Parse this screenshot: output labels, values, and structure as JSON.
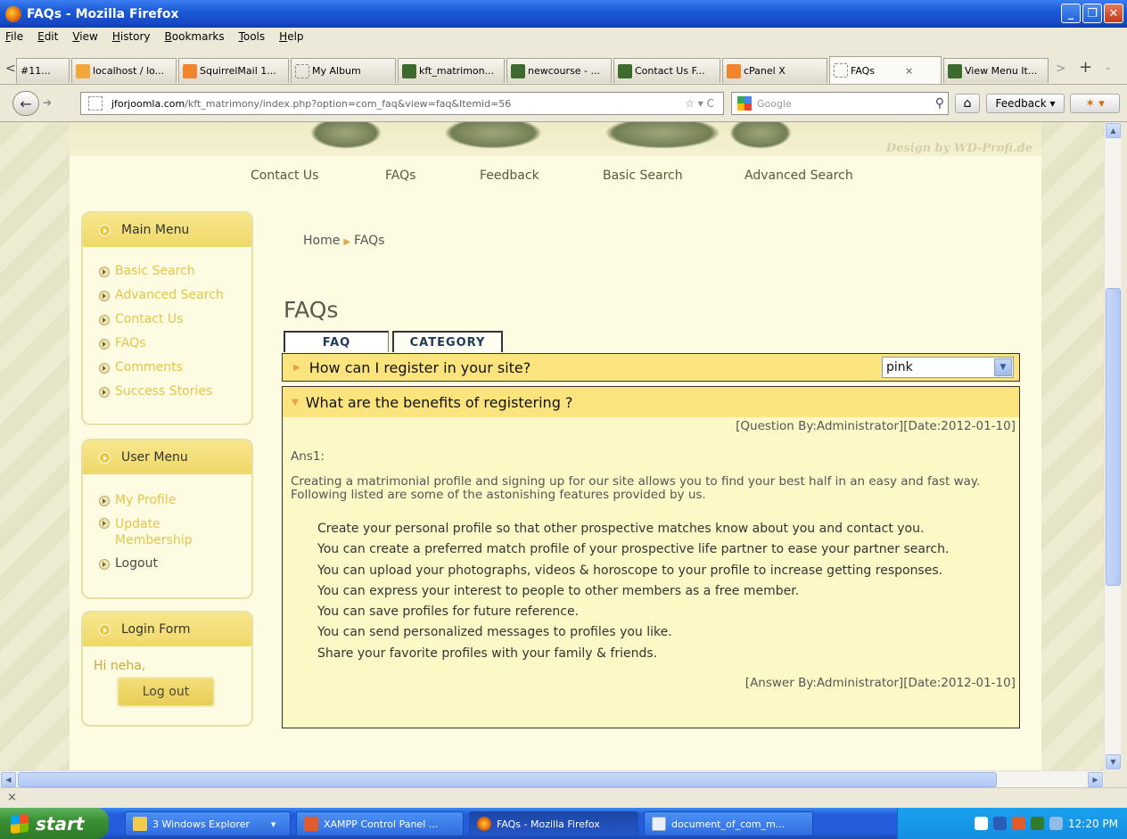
{
  "window": {
    "title": "FAQs - Mozilla Firefox"
  },
  "menubar": [
    "File",
    "Edit",
    "View",
    "History",
    "Bookmarks",
    "Tools",
    "Help"
  ],
  "tabs": [
    {
      "label": "#11...",
      "icon": "none"
    },
    {
      "label": "localhost / lo...",
      "icon": "phpmyadmin-icon"
    },
    {
      "label": "SquirrelMail 1...",
      "icon": "cpanel-icon"
    },
    {
      "label": "My Album",
      "icon": "blank-page-icon"
    },
    {
      "label": "kft_matrimon...",
      "icon": "joomla-icon"
    },
    {
      "label": "newcourse - ...",
      "icon": "joomla-icon"
    },
    {
      "label": "Contact Us F...",
      "icon": "joomla-icon"
    },
    {
      "label": "cPanel X",
      "icon": "cpanel-icon"
    },
    {
      "label": "FAQs",
      "icon": "blank-page-icon",
      "active": true
    },
    {
      "label": "View Menu It...",
      "icon": "joomla-icon"
    }
  ],
  "navbar": {
    "url_domain": "jforjoomla.com",
    "url_path": "/kft_matrimony/index.php?option=com_faq&view=faq&Itemid=56",
    "search_placeholder": "Google",
    "feedback_label": "Feedback"
  },
  "page": {
    "design_credit": "Design by WD-Profi.de",
    "topnav": [
      "Contact Us",
      "FAQs",
      "Feedback",
      "Basic Search",
      "Advanced Search"
    ],
    "main_menu": {
      "title": "Main Menu",
      "items": [
        "Basic Search",
        "Advanced Search",
        "Contact Us",
        "FAQs",
        "Comments",
        "Success Stories"
      ]
    },
    "user_menu": {
      "title": "User Menu",
      "items": [
        "My Profile",
        "Update Membership",
        "Logout"
      ]
    },
    "login_form": {
      "title": "Login Form",
      "greeting": "Hi neha,",
      "logout_button": "Log out"
    },
    "breadcrumb": {
      "home": "Home",
      "current": "FAQs"
    },
    "heading": "FAQs",
    "faq_tabs": [
      "FAQ",
      "CATEGORY"
    ],
    "theme_select": "pink",
    "questions": [
      {
        "question": "How can I register in your site?",
        "expanded": false
      },
      {
        "question": "What are the benefits of registering ?",
        "expanded": true,
        "question_meta": "[Question By:Administrator][Date:2012-01-10]",
        "answer_label": "Ans1:",
        "answer_intro": "Creating a matrimonial profile and signing up for our site allows you to find your best half in an easy and fast way. Following listed are some of the astonishing features provided by us.",
        "answer_points": [
          "Create your personal profile so that other prospective matches know about you and contact you.",
          "You can create a preferred match profile of your prospective life partner to ease your partner search.",
          "You can upload your photographs, videos & horoscope to your profile to increase getting responses.",
          "You can express your interest to people to other members as a free member.",
          "You can save profiles for future reference.",
          "You can send personalized messages to profiles you like.",
          "Share your favorite profiles with your family & friends."
        ],
        "answer_meta": "[Answer By:Administrator][Date:2012-01-10]"
      }
    ]
  },
  "taskbar": {
    "start_label": "start",
    "tasks": [
      "3 Windows Explorer",
      "XAMPP Control Panel ...",
      "FAQs - Mozilla Firefox",
      "document_of_com_m..."
    ],
    "clock": "12:20 PM"
  }
}
